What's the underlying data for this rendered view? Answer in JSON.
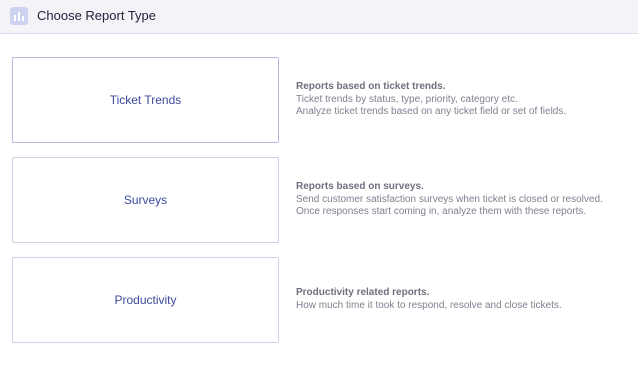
{
  "header": {
    "icon": "bar-chart-icon",
    "title": "Choose Report Type"
  },
  "report_types": [
    {
      "label": "Ticket Trends",
      "description_title": "Reports based on ticket trends.",
      "description_lines": [
        "Ticket trends by status, type, priority, category etc.",
        "Analyze ticket trends based on any ticket field or set of fields."
      ]
    },
    {
      "label": "Surveys",
      "description_title": "Reports based on surveys.",
      "description_lines": [
        "Send customer satisfaction surveys when ticket is closed or resolved.",
        "Once responses start coming in, analyze them with these reports."
      ]
    },
    {
      "label": "Productivity",
      "description_title": "Productivity related reports.",
      "description_lines": [
        "How much time it took to respond, resolve and close tickets."
      ]
    }
  ]
}
